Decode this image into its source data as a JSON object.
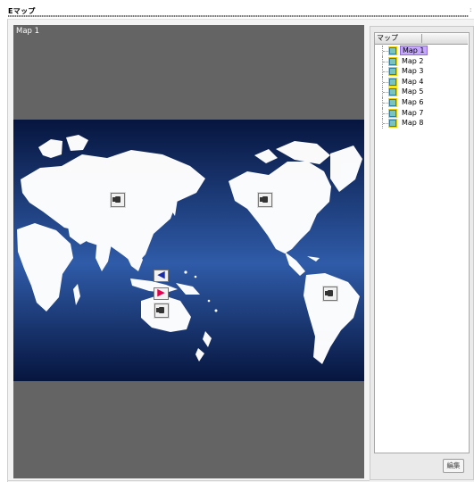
{
  "window": {
    "title": "Eマップ"
  },
  "map": {
    "label": "Map 1",
    "markers": [
      {
        "type": "camera-icon"
      },
      {
        "type": "camera-icon"
      },
      {
        "type": "camera-icon"
      },
      {
        "type": "camera-icon"
      }
    ],
    "arrows": [
      {
        "direction": "left",
        "color": "#1b2ca3"
      },
      {
        "direction": "right",
        "color": "#e6004d"
      }
    ]
  },
  "tree": {
    "header": "マップ",
    "items": [
      {
        "label": "Map 1",
        "selected": true
      },
      {
        "label": "Map 2",
        "selected": false
      },
      {
        "label": "Map 3",
        "selected": false
      },
      {
        "label": "Map 4",
        "selected": false
      },
      {
        "label": "Map 5",
        "selected": false
      },
      {
        "label": "Map 6",
        "selected": false
      },
      {
        "label": "Map 7",
        "selected": false
      },
      {
        "label": "Map 8",
        "selected": false
      }
    ]
  },
  "buttons": {
    "edit": "編集"
  },
  "colors": {
    "map_background": "#646464",
    "ocean_dark": "#06153e",
    "ocean_light": "#2f5ba8",
    "selection": "#c5a7ff"
  }
}
